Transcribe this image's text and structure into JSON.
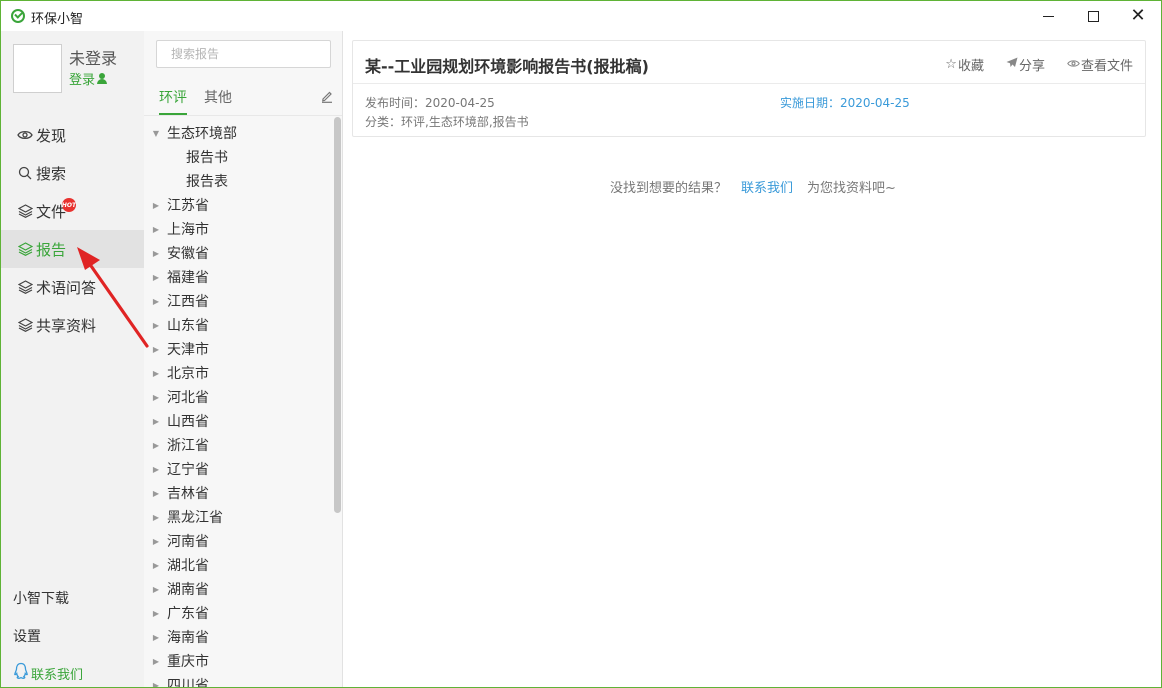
{
  "app": {
    "title": "环保小智"
  },
  "window_controls": {
    "minimize": "minimize",
    "maximize": "maximize",
    "close": "close"
  },
  "user": {
    "name": "未登录",
    "login_label": "登录"
  },
  "nav": {
    "items": [
      {
        "label": "发现",
        "icon": "eye-icon"
      },
      {
        "label": "搜索",
        "icon": "search-icon"
      },
      {
        "label": "文件",
        "icon": "layers-icon",
        "badge": "HOT"
      },
      {
        "label": "报告",
        "icon": "layers-icon",
        "active": true
      },
      {
        "label": "术语问答",
        "icon": "layers-icon"
      },
      {
        "label": "共享资料",
        "icon": "layers-icon"
      }
    ],
    "bottom": {
      "download": "小智下载",
      "settings": "设置",
      "contact": "联系我们"
    }
  },
  "tree_panel": {
    "search_placeholder": "搜索报告",
    "tabs": [
      "环评",
      "其他"
    ],
    "active_tab": "环评",
    "root": {
      "label": "生态环境部",
      "expanded": true,
      "children": [
        "报告书",
        "报告表"
      ]
    },
    "provinces": [
      "江苏省",
      "上海市",
      "安徽省",
      "福建省",
      "江西省",
      "山东省",
      "天津市",
      "北京市",
      "河北省",
      "山西省",
      "浙江省",
      "辽宁省",
      "吉林省",
      "黑龙江省",
      "河南省",
      "湖北省",
      "湖南省",
      "广东省",
      "海南省",
      "重庆市",
      "四川省"
    ]
  },
  "document": {
    "title": "某--工业园规划环境影响报告书(报批稿)",
    "actions": {
      "favorite": "收藏",
      "share": "分享",
      "view": "查看文件"
    },
    "publish": "发布时间：2020-04-25",
    "effective": "实施日期：2020-04-25",
    "category": "分类：环评,生态环境部,报告书"
  },
  "empty_state": {
    "prefix": "没找到想要的结果？",
    "link": "联系我们",
    "suffix": "为您找资料吧~"
  },
  "colors": {
    "accent": "#3aa53a",
    "link": "#3a9ad9",
    "arrow": "#e02424"
  }
}
